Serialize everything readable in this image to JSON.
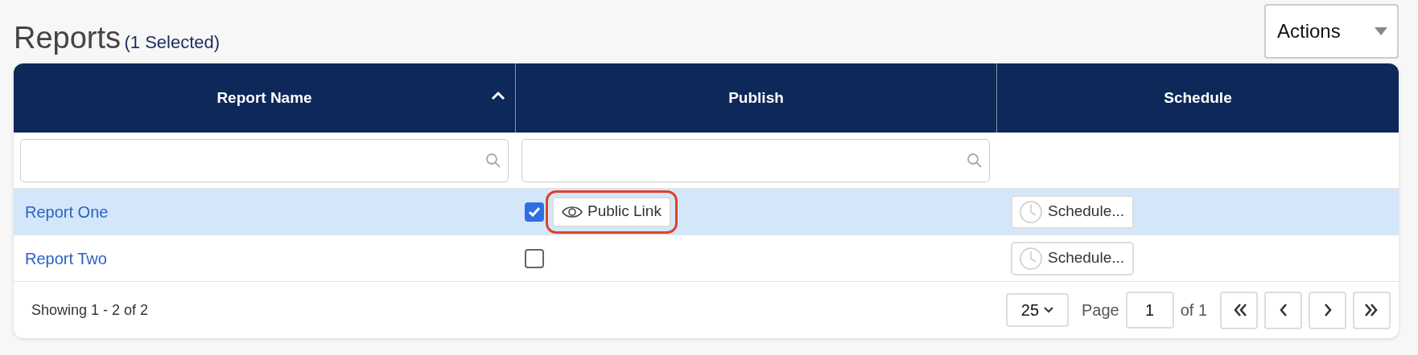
{
  "title": "Reports",
  "selection_note": "(1 Selected)",
  "actions_button": {
    "label": "Actions"
  },
  "table": {
    "columns": [
      {
        "label": "Report Name",
        "sorted": true,
        "has_filter": true
      },
      {
        "label": "Publish",
        "sorted": false,
        "has_filter": true
      },
      {
        "label": "Schedule",
        "sorted": false,
        "has_filter": false
      }
    ],
    "rows": [
      {
        "name": "Report One",
        "selected": true,
        "checked": true,
        "public_link": {
          "label": "Public Link",
          "highlighted": true
        },
        "schedule_label": "Schedule..."
      },
      {
        "name": "Report Two",
        "selected": false,
        "checked": false,
        "schedule_label": "Schedule..."
      }
    ]
  },
  "footer": {
    "summary": "Showing 1 - 2 of 2",
    "page_size": "25",
    "page_label": "Page",
    "page": "1",
    "page_total": "of 1"
  }
}
